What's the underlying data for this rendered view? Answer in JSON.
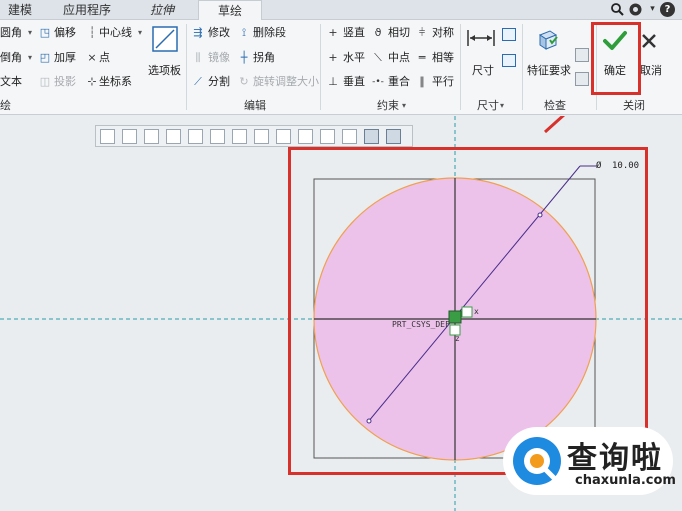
{
  "tabs": [
    {
      "label": "建模",
      "active": false
    },
    {
      "label": "应用程序",
      "active": false
    },
    {
      "label": "拉伸",
      "active": false
    },
    {
      "label": "草绘",
      "active": true
    }
  ],
  "quick_access": {
    "icons": [
      "search-icon",
      "settings-icon",
      "help-icon"
    ],
    "help_glyph": "?"
  },
  "ribbon": {
    "sketch_group": {
      "label": "绘",
      "items": {
        "round": "圆角",
        "chamfer": "倒角",
        "text": "文本",
        "offset": "偏移",
        "thicken": "加厚",
        "project": "投影",
        "centerline": "中心线",
        "point": "点",
        "csys": "坐标系",
        "palette": "选项板"
      }
    },
    "edit_group": {
      "label": "编辑",
      "items": {
        "modify": "修改",
        "delete_segment": "删除段",
        "mirror": "镜像",
        "corner": "拐角",
        "divide": "分割",
        "rotate_resize": "旋转调整大小"
      }
    },
    "constrain_group": {
      "label": "约束",
      "items": {
        "vertical": "竖直",
        "tangent": "相切",
        "symmetric": "对称",
        "horizontal": "水平",
        "midpoint": "中点",
        "equal": "相等",
        "perpendicular": "垂直",
        "coincident": "重合",
        "parallel": "平行"
      }
    },
    "dimension_group": {
      "label": "尺寸",
      "item": "尺寸"
    },
    "inspect_group": {
      "label": "检查",
      "item": "特征要求"
    },
    "close_group": {
      "label": "关闭",
      "ok": "确定",
      "cancel": "取消"
    }
  },
  "sketch": {
    "dimension_label": "10.00",
    "dimension_symbol": "Ø",
    "csys_label": "PRT_CSYS_DEF",
    "axis_x": "x",
    "axis_z": "z",
    "circle_fill": "#ecc2ea",
    "circle_stroke": "#f0a050"
  },
  "colors": {
    "accent_red": "#d8302b",
    "ok_green": "#2f9e3a",
    "centerline": "#2a9aa8"
  },
  "watermark": {
    "title": "查询啦",
    "url": "chaxunla.com"
  }
}
